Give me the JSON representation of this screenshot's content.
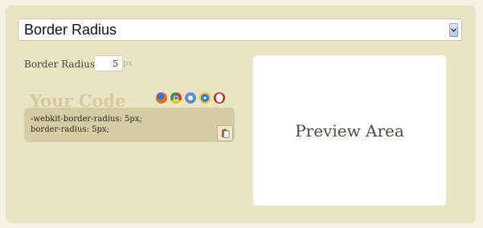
{
  "effect_select": {
    "value": "Border Radius"
  },
  "border_radius": {
    "label": "Border Radius:",
    "value": "5",
    "unit": "px"
  },
  "code": {
    "heading": "Your Code",
    "lines": [
      "-webkit-border-radius: 5px;",
      "border-radius: 5px;"
    ],
    "browser_icons": [
      "firefox-icon",
      "chrome-icon",
      "safari-icon",
      "ie-icon",
      "opera-icon"
    ]
  },
  "preview": {
    "text": "Preview Area"
  },
  "colors": {
    "panel": "#ebe4c4",
    "code_box": "#d6cca4",
    "heading": "#d4c9a0"
  }
}
